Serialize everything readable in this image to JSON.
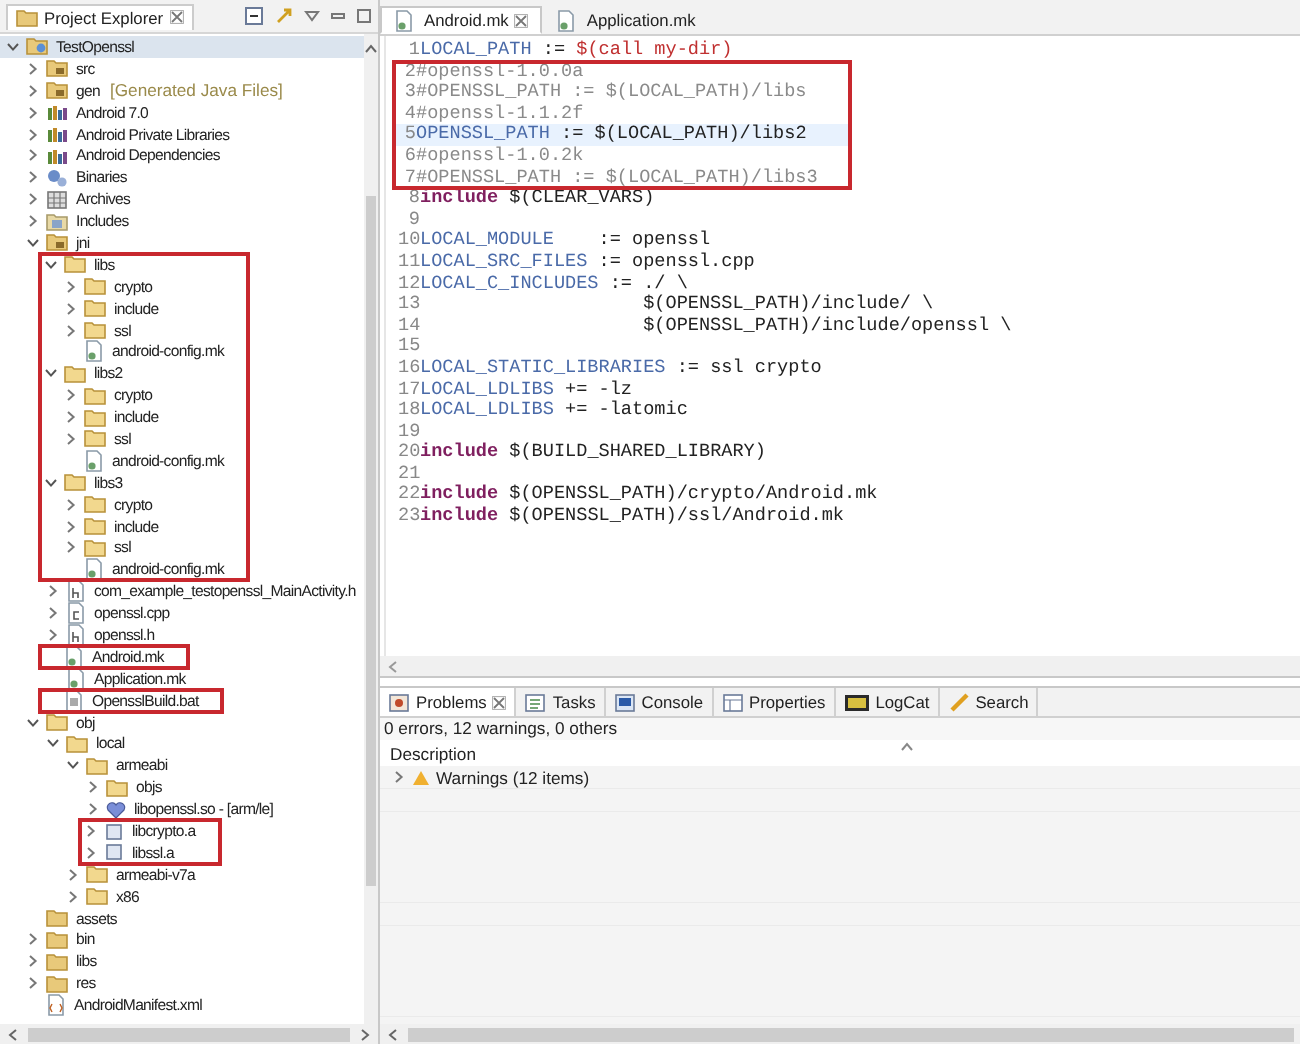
{
  "project_explorer": {
    "title": "Project Explorer",
    "items": [
      {
        "label": "TestOpenssl",
        "kind": "project",
        "expanded": true,
        "selected": true,
        "highlighted": false,
        "children": [
          {
            "label": "src",
            "kind": "source_folder",
            "expanded": false,
            "selected": false,
            "highlighted": false
          },
          {
            "label": "gen",
            "decoration": "[Generated Java Files]",
            "kind": "source_folder",
            "expanded": false,
            "selected": false,
            "highlighted": false
          },
          {
            "label": "Android 7.0",
            "kind": "library",
            "expanded": false,
            "selected": false,
            "highlighted": false
          },
          {
            "label": "Android Private Libraries",
            "kind": "library",
            "expanded": false,
            "selected": false,
            "highlighted": false
          },
          {
            "label": "Android Dependencies",
            "kind": "library",
            "expanded": false,
            "selected": false,
            "highlighted": false
          },
          {
            "label": "Binaries",
            "kind": "binaries",
            "expanded": false,
            "selected": false,
            "highlighted": false
          },
          {
            "label": "Archives",
            "kind": "archives",
            "expanded": false,
            "selected": false,
            "highlighted": false
          },
          {
            "label": "Includes",
            "kind": "includes",
            "expanded": false,
            "selected": false,
            "highlighted": false
          },
          {
            "label": "jni",
            "kind": "source_folder",
            "expanded": true,
            "selected": false,
            "highlighted": false,
            "children": [
              {
                "label": "libs",
                "kind": "folder",
                "expanded": true,
                "selected": false,
                "highlighted": true,
                "children": [
                  {
                    "label": "crypto",
                    "kind": "folder",
                    "expanded": false,
                    "selected": false,
                    "highlighted": true
                  },
                  {
                    "label": "include",
                    "kind": "folder",
                    "expanded": false,
                    "selected": false,
                    "highlighted": true
                  },
                  {
                    "label": "ssl",
                    "kind": "folder",
                    "expanded": false,
                    "selected": false,
                    "highlighted": true
                  },
                  {
                    "label": "android-config.mk",
                    "kind": "file",
                    "selected": false,
                    "highlighted": true
                  }
                ]
              },
              {
                "label": "libs2",
                "kind": "folder",
                "expanded": true,
                "selected": false,
                "highlighted": true,
                "children": [
                  {
                    "label": "crypto",
                    "kind": "folder",
                    "expanded": false,
                    "selected": false,
                    "highlighted": true
                  },
                  {
                    "label": "include",
                    "kind": "folder",
                    "expanded": false,
                    "selected": false,
                    "highlighted": true
                  },
                  {
                    "label": "ssl",
                    "kind": "folder",
                    "expanded": false,
                    "selected": false,
                    "highlighted": true
                  },
                  {
                    "label": "android-config.mk",
                    "kind": "file",
                    "selected": false,
                    "highlighted": true
                  }
                ]
              },
              {
                "label": "libs3",
                "kind": "folder",
                "expanded": true,
                "selected": false,
                "highlighted": true,
                "children": [
                  {
                    "label": "crypto",
                    "kind": "folder",
                    "expanded": false,
                    "selected": false,
                    "highlighted": true
                  },
                  {
                    "label": "include",
                    "kind": "folder",
                    "expanded": false,
                    "selected": false,
                    "highlighted": true
                  },
                  {
                    "label": "ssl",
                    "kind": "folder",
                    "expanded": false,
                    "selected": false,
                    "highlighted": true
                  },
                  {
                    "label": "android-config.mk",
                    "kind": "file",
                    "selected": false,
                    "highlighted": true
                  }
                ]
              },
              {
                "label": "com_example_testopenssl_MainActivity.h",
                "kind": "header",
                "expanded": false,
                "selected": false,
                "highlighted": false
              },
              {
                "label": "openssl.cpp",
                "kind": "source",
                "expanded": false,
                "selected": false,
                "highlighted": false
              },
              {
                "label": "openssl.h",
                "kind": "header",
                "expanded": false,
                "selected": false,
                "highlighted": false
              },
              {
                "label": "Android.mk",
                "kind": "file",
                "selected": false,
                "highlighted": true
              },
              {
                "label": "Application.mk",
                "kind": "file",
                "selected": false,
                "highlighted": false
              },
              {
                "label": "OpensslBuild.bat",
                "kind": "batch",
                "selected": false,
                "highlighted": true
              }
            ]
          },
          {
            "label": "obj",
            "kind": "folder",
            "expanded": true,
            "selected": false,
            "highlighted": false,
            "children": [
              {
                "label": "local",
                "kind": "folder",
                "expanded": true,
                "selected": false,
                "highlighted": false,
                "children": [
                  {
                    "label": "armeabi",
                    "kind": "folder",
                    "expanded": true,
                    "selected": false,
                    "highlighted": false,
                    "children": [
                      {
                        "label": "objs",
                        "kind": "folder",
                        "expanded": false,
                        "selected": false,
                        "highlighted": false
                      },
                      {
                        "label": "libopenssl.so - [arm/le]",
                        "kind": "shared_lib",
                        "expanded": false,
                        "selected": false,
                        "highlighted": false
                      },
                      {
                        "label": "libcrypto.a",
                        "kind": "static_lib",
                        "expanded": false,
                        "selected": false,
                        "highlighted": true
                      },
                      {
                        "label": "libssl.a",
                        "kind": "static_lib",
                        "expanded": false,
                        "selected": false,
                        "highlighted": true
                      }
                    ]
                  },
                  {
                    "label": "armeabi-v7a",
                    "kind": "folder",
                    "expanded": false,
                    "selected": false,
                    "highlighted": false
                  },
                  {
                    "label": "x86",
                    "kind": "folder",
                    "expanded": false,
                    "selected": false,
                    "highlighted": false
                  }
                ]
              }
            ]
          },
          {
            "label": "assets",
            "kind": "project_folder",
            "selected": false,
            "highlighted": false
          },
          {
            "label": "bin",
            "kind": "project_folder",
            "expanded": false,
            "selected": false,
            "highlighted": false
          },
          {
            "label": "libs",
            "kind": "project_folder",
            "expanded": false,
            "selected": false,
            "highlighted": false
          },
          {
            "label": "res",
            "kind": "project_folder",
            "expanded": false,
            "selected": false,
            "highlighted": false
          },
          {
            "label": "AndroidManifest.xml",
            "kind": "xml",
            "selected": false,
            "highlighted": false
          }
        ]
      }
    ]
  },
  "editor": {
    "tabs": [
      {
        "label": "Android.mk",
        "selected": true
      },
      {
        "label": "Application.mk",
        "selected": false
      }
    ],
    "lines": [
      {
        "number": "1",
        "current": false,
        "highlighted": false,
        "segments": [
          {
            "text": "LOCAL_PATH",
            "kind": "var"
          },
          {
            "text": " := ",
            "kind": "plain"
          },
          {
            "text": "$(call my-dir)",
            "kind": "func"
          }
        ]
      },
      {
        "number": "2",
        "current": false,
        "highlighted": true,
        "segments": [
          {
            "text": "#openssl-1.0.0a",
            "kind": "comment"
          }
        ]
      },
      {
        "number": "3",
        "current": false,
        "highlighted": true,
        "segments": [
          {
            "text": "#OPENSSL_PATH := $(LOCAL_PATH)/libs",
            "kind": "comment"
          }
        ]
      },
      {
        "number": "4",
        "current": false,
        "highlighted": true,
        "segments": [
          {
            "text": "#openssl-1.1.2f",
            "kind": "comment"
          }
        ]
      },
      {
        "number": "5",
        "current": true,
        "highlighted": true,
        "segments": [
          {
            "text": "OPENSSL_PATH",
            "kind": "var"
          },
          {
            "text": " := $(LOCAL_PATH)/libs2",
            "kind": "plain"
          }
        ]
      },
      {
        "number": "6",
        "current": false,
        "highlighted": true,
        "segments": [
          {
            "text": "#openssl-1.0.2k",
            "kind": "comment"
          }
        ]
      },
      {
        "number": "7",
        "current": false,
        "highlighted": true,
        "segments": [
          {
            "text": "#OPENSSL_PATH := $(LOCAL_PATH)/libs3",
            "kind": "comment"
          }
        ]
      },
      {
        "number": "8",
        "current": false,
        "highlighted": false,
        "segments": [
          {
            "text": "include",
            "kind": "keyword"
          },
          {
            "text": " $(CLEAR_VARS)",
            "kind": "plain"
          }
        ]
      },
      {
        "number": "9",
        "current": false,
        "highlighted": false
      },
      {
        "number": "10",
        "current": false,
        "highlighted": false,
        "segments": [
          {
            "text": "LOCAL_MODULE",
            "kind": "var"
          },
          {
            "text": "    := openssl",
            "kind": "plain"
          }
        ]
      },
      {
        "number": "11",
        "current": false,
        "highlighted": false,
        "segments": [
          {
            "text": "LOCAL_SRC_FILES",
            "kind": "var"
          },
          {
            "text": " := openssl.cpp",
            "kind": "plain"
          }
        ]
      },
      {
        "number": "12",
        "current": false,
        "highlighted": false,
        "segments": [
          {
            "text": "LOCAL_C_INCLUDES",
            "kind": "var"
          },
          {
            "text": " := ./ \\",
            "kind": "plain"
          }
        ]
      },
      {
        "number": "13",
        "current": false,
        "highlighted": false,
        "segments": [
          {
            "text": "                    $(OPENSSL_PATH)/include/ \\",
            "kind": "plain"
          }
        ]
      },
      {
        "number": "14",
        "current": false,
        "highlighted": false,
        "segments": [
          {
            "text": "                    $(OPENSSL_PATH)/include/openssl \\",
            "kind": "plain"
          }
        ]
      },
      {
        "number": "15",
        "current": false,
        "highlighted": false
      },
      {
        "number": "16",
        "current": false,
        "highlighted": false,
        "segments": [
          {
            "text": "LOCAL_STATIC_LIBRARIES",
            "kind": "var"
          },
          {
            "text": " := ssl crypto",
            "kind": "plain"
          }
        ]
      },
      {
        "number": "17",
        "current": false,
        "highlighted": false,
        "segments": [
          {
            "text": "LOCAL_LDLIBS",
            "kind": "var"
          },
          {
            "text": " += -lz",
            "kind": "plain"
          }
        ]
      },
      {
        "number": "18",
        "current": false,
        "highlighted": false,
        "segments": [
          {
            "text": "LOCAL_LDLIBS",
            "kind": "var"
          },
          {
            "text": " += -latomic",
            "kind": "plain"
          }
        ]
      },
      {
        "number": "19",
        "current": false,
        "highlighted": false
      },
      {
        "number": "20",
        "current": false,
        "highlighted": false,
        "segments": [
          {
            "text": "include",
            "kind": "keyword"
          },
          {
            "text": " $(BUILD_SHARED_LIBRARY)",
            "kind": "plain"
          }
        ]
      },
      {
        "number": "21",
        "current": false,
        "highlighted": false
      },
      {
        "number": "22",
        "current": false,
        "highlighted": false,
        "segments": [
          {
            "text": "include",
            "kind": "keyword"
          },
          {
            "text": " $(OPENSSL_PATH)/crypto/Android.mk",
            "kind": "plain"
          }
        ]
      },
      {
        "number": "23",
        "current": false,
        "highlighted": false,
        "segments": [
          {
            "text": "include",
            "kind": "keyword"
          },
          {
            "text": " $(OPENSSL_PATH)/ssl/Android.mk",
            "kind": "plain"
          }
        ]
      }
    ]
  },
  "bottom_panel": {
    "tabs": [
      {
        "label": "Problems",
        "kind": "problems",
        "selected": true
      },
      {
        "label": "Tasks",
        "kind": "tasks",
        "selected": false
      },
      {
        "label": "Console",
        "kind": "console",
        "selected": false
      },
      {
        "label": "Properties",
        "kind": "properties",
        "selected": false
      },
      {
        "label": "LogCat",
        "kind": "logcat",
        "selected": false
      },
      {
        "label": "Search",
        "kind": "search",
        "selected": false
      }
    ],
    "summary": "0 errors, 12 warnings, 0 others",
    "columns": [
      "Description"
    ],
    "rows": [
      {
        "label": "Warnings (12 items)",
        "kind": "warning",
        "expanded": false
      }
    ]
  }
}
